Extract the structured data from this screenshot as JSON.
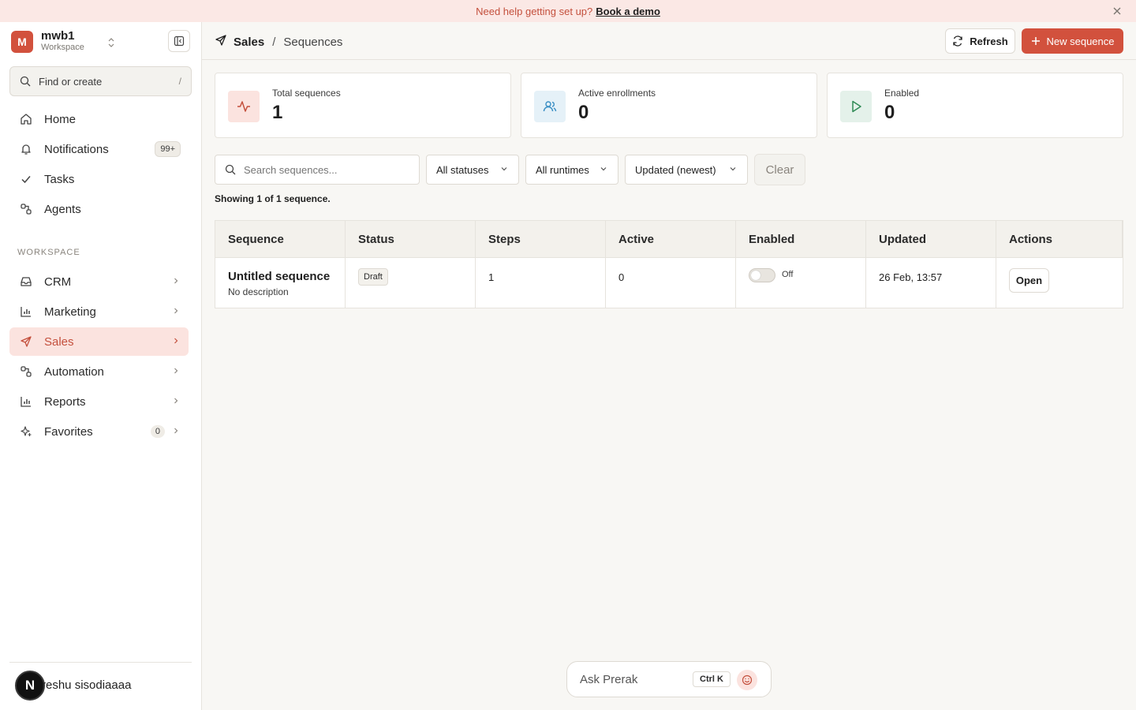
{
  "banner": {
    "text": "Need help getting set up?",
    "link": "Book a demo"
  },
  "workspace": {
    "initial": "M",
    "name": "mwb1",
    "subtitle": "Workspace"
  },
  "find": {
    "label": "Find or create",
    "shortcut": "/"
  },
  "nav_top": [
    {
      "label": "Home",
      "icon": "home-icon"
    },
    {
      "label": "Notifications",
      "icon": "bell-icon",
      "badge": "99+"
    },
    {
      "label": "Tasks",
      "icon": "check-icon"
    },
    {
      "label": "Agents",
      "icon": "agents-icon"
    }
  ],
  "section_label": "WORKSPACE",
  "nav_ws": [
    {
      "label": "CRM",
      "icon": "inbox-icon"
    },
    {
      "label": "Marketing",
      "icon": "bar-chart-icon"
    },
    {
      "label": "Sales",
      "icon": "send-icon",
      "active": true
    },
    {
      "label": "Automation",
      "icon": "workflow-icon"
    },
    {
      "label": "Reports",
      "icon": "reports-icon"
    },
    {
      "label": "Favorites",
      "icon": "sparkle-icon",
      "count": "0"
    }
  ],
  "user": {
    "initial": "N",
    "name": "reshu sisodiaaaa"
  },
  "header": {
    "crumb1": "Sales",
    "sep": "/",
    "crumb2": "Sequences",
    "refresh": "Refresh",
    "new": "New sequence"
  },
  "stats": [
    {
      "label": "Total sequences",
      "value": "1"
    },
    {
      "label": "Active enrollments",
      "value": "0"
    },
    {
      "label": "Enabled",
      "value": "0"
    }
  ],
  "filters": {
    "search_placeholder": "Search sequences...",
    "status": "All statuses",
    "runtime": "All runtimes",
    "sort": "Updated (newest)",
    "clear": "Clear"
  },
  "showing": "Showing 1 of 1 sequence.",
  "table": {
    "columns": [
      "Sequence",
      "Status",
      "Steps",
      "Active",
      "Enabled",
      "Updated",
      "Actions"
    ],
    "rows": [
      {
        "name": "Untitled sequence",
        "desc": "No description",
        "status": "Draft",
        "steps": "1",
        "active": "0",
        "enabled": "Off",
        "updated": "26 Feb, 13:57",
        "action": "Open"
      }
    ]
  },
  "ask": {
    "label": "Ask Prerak",
    "shortcut": "Ctrl K"
  },
  "colors": {
    "accent": "#d2513d",
    "accent_soft": "#fbe3df",
    "banner_bg": "#fbe8e5"
  }
}
